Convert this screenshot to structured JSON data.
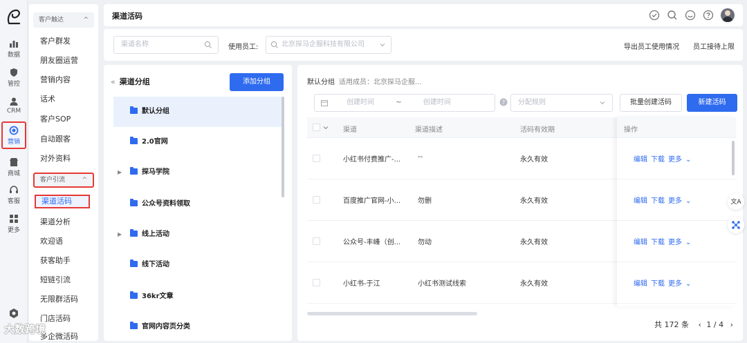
{
  "rail": {
    "items": [
      {
        "label": "数据",
        "icon": "bar-chart-icon"
      },
      {
        "label": "管控",
        "icon": "shield-icon"
      },
      {
        "label": "CRM",
        "icon": "user-icon"
      },
      {
        "label": "营销",
        "icon": "target-icon"
      },
      {
        "label": "商城",
        "icon": "shop-icon"
      },
      {
        "label": "客服",
        "icon": "headset-icon"
      },
      {
        "label": "更多",
        "icon": "grid-icon"
      }
    ]
  },
  "sidebar": {
    "group1": "客户触达",
    "group1_items": [
      "客户群发",
      "朋友圈运营",
      "营销内容",
      "话术",
      "客户SOP",
      "自动跟客",
      "对外资料"
    ],
    "group2": "客户引流",
    "group2_items": [
      "渠道活码",
      "渠道分析",
      "欢迎语",
      "获客助手",
      "短链引流",
      "无限群活码",
      "门店活码",
      "多企微活码"
    ]
  },
  "header": {
    "title": "渠道活码"
  },
  "filters": {
    "channel_placeholder": "渠道名称",
    "employee_label": "使用员工:",
    "employee_value": "北京探马企服科技有限公司",
    "export_link": "导出员工使用情况",
    "limit_link": "员工接待上限"
  },
  "groups": {
    "title": "渠道分组",
    "add_button": "添加分组",
    "items": [
      "默认分组",
      "2.0官网",
      "探马学院",
      "公众号资料领取",
      "线上活动",
      "线下活动",
      "36kr文章",
      "官网内容页分类"
    ]
  },
  "main": {
    "crumb_group": "默认分组",
    "crumb_members": "适用成员：北京探马企服...",
    "start_placeholder": "创建时间",
    "range_sep": "~",
    "end_placeholder": "创建时间",
    "rule_placeholder": "分配规则",
    "batch_button": "批量创建活码",
    "new_button": "新建活码",
    "columns": [
      "渠道",
      "渠道描述",
      "活码有效期",
      "操作"
    ],
    "rows": [
      {
        "channel": "小红书付费推广-...",
        "desc": "--",
        "validity": "永久有效"
      },
      {
        "channel": "百度推广官网-小...",
        "desc": "勿删",
        "validity": "永久有效"
      },
      {
        "channel": "公众号-丰峰（创...",
        "desc": "勿动",
        "validity": "永久有效"
      },
      {
        "channel": "小红书-于江",
        "desc": "小红书测试线索",
        "validity": "永久有效"
      }
    ],
    "ops": {
      "edit": "编辑",
      "download": "下载",
      "more": "更多"
    },
    "total": "共 172 条",
    "page": "1 / 4",
    "prev": "‹",
    "next": "›"
  },
  "floating": {
    "translate": "文A"
  },
  "watermark": "大数跨境"
}
